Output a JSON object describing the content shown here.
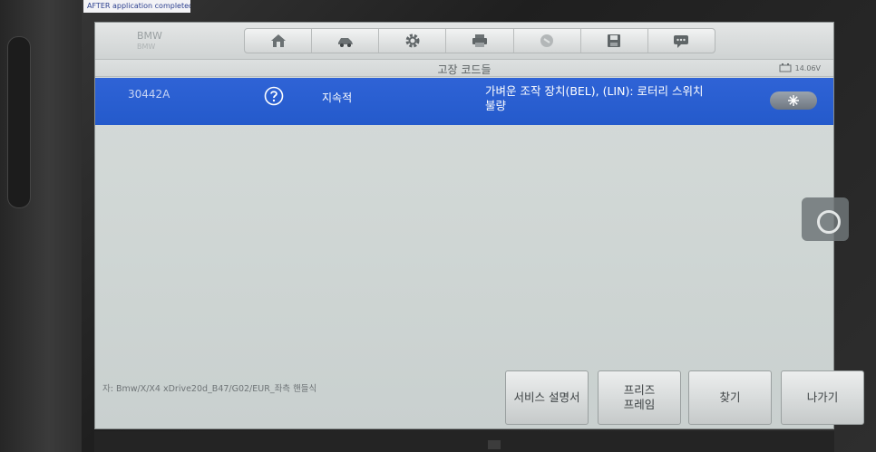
{
  "sticker": {
    "text": "AFTER application completed"
  },
  "vehicle": {
    "brand": "BMW",
    "sub": "BMW"
  },
  "toolbar": {
    "icons": [
      "home-icon",
      "vehicle-swap-icon",
      "gear-icon",
      "printer-icon",
      "help-icon",
      "save-icon",
      "message-icon"
    ]
  },
  "title": "고장 코드들",
  "battery": {
    "voltage": "14.06V"
  },
  "dtc": {
    "code": "30442A",
    "status": "지속적",
    "description_line1": "가벼운 조작 장치(BEL), (LIN): 로터리 스위치",
    "description_line2": "불량",
    "selected_color": "#2f63d6"
  },
  "vehicle_path": "자: Bmw/X/X4 xDrive20d_B47/G02/EUR_좌측 핸들식",
  "buttons": {
    "service_manual": "서비스 설명서",
    "freeze_frame_line1": "프리즈",
    "freeze_frame_line2": "프레임",
    "find": "찾기",
    "exit": "나가기"
  }
}
